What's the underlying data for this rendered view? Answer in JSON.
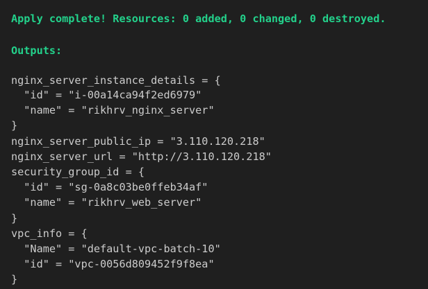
{
  "terminal": {
    "apply_line": "Apply complete! Resources: 0 added, 0 changed, 0 destroyed.",
    "outputs_header": "Outputs:",
    "lines": [
      "nginx_server_instance_details = {",
      "  \"id\" = \"i-00a14ca94f2ed6979\"",
      "  \"name\" = \"rikhrv_nginx_server\"",
      "}",
      "nginx_server_public_ip = \"3.110.120.218\"",
      "nginx_server_url = \"http://3.110.120.218\"",
      "security_group_id = {",
      "  \"id\" = \"sg-0a8c03be0ffeb34af\"",
      "  \"name\" = \"rikhrv_web_server\"",
      "}",
      "vpc_info = {",
      "  \"Name\" = \"default-vpc-batch-10\"",
      "  \"id\" = \"vpc-0056d809452f9f8ea\"",
      "}"
    ]
  },
  "colors": {
    "background": "#1f1f1f",
    "foreground": "#cccccc",
    "success_green": "#23d18b"
  }
}
